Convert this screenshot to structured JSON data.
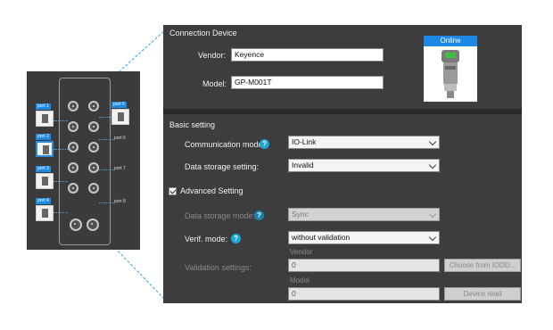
{
  "module": {
    "ports": [
      {
        "label": "port 1"
      },
      {
        "label": "port 2"
      },
      {
        "label": "port 3"
      },
      {
        "label": "port 4"
      },
      {
        "label": "port 5"
      },
      {
        "label": "port 6"
      },
      {
        "label": "port 7"
      },
      {
        "label": "port 8"
      }
    ]
  },
  "connection": {
    "title": "Connection Device",
    "vendor_label": "Vendor:",
    "vendor_value": "Keyence",
    "model_label": "Model:",
    "model_value": "GP-M001T",
    "status": "Online"
  },
  "basic": {
    "title": "Basic setting",
    "comm_label": "Communication mode:",
    "comm_value": "IO-Link",
    "storage_label": "Data storage setting:",
    "storage_value": "Invalid"
  },
  "advanced": {
    "title": "Advanced Setting",
    "checked": true,
    "storage_mode_label": "Data storage mode:",
    "storage_mode_value": "Sync",
    "verif_label": "Verif. mode:",
    "verif_value": "without validation",
    "validation_label": "Validation settings:",
    "vendor_caption": "Vendor",
    "vendor_value": "0",
    "choose_button": "Choose from IODD...",
    "model_caption": "Model",
    "model_value": "0",
    "device_read_button": "Device read"
  },
  "help_symbol": "?",
  "colors": {
    "panel_bg": "#3d3d3d",
    "accent_blue": "#1e88e5",
    "help_icon": "#1aa6d9"
  }
}
